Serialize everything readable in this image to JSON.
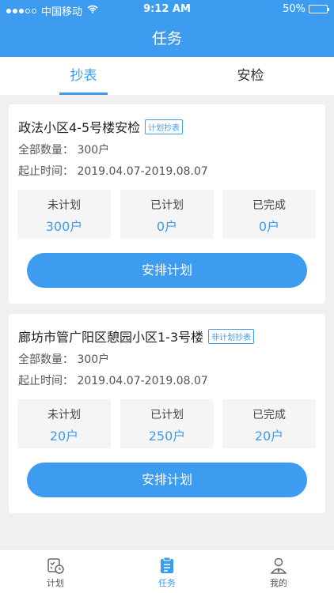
{
  "status_bar": {
    "carrier": "中国移动",
    "time": "9:12 AM",
    "battery": "50%"
  },
  "header": {
    "title": "任务"
  },
  "tabs": [
    {
      "label": "抄表"
    },
    {
      "label": "安检"
    }
  ],
  "tasks": [
    {
      "name": "政法小区4-5号楼安检",
      "tag": "计划抄表",
      "total": "全部数量：  300户",
      "period": "起止时间：  2019.04.07-2019.08.07",
      "stats": [
        {
          "label": "未计划",
          "value": "300户"
        },
        {
          "label": "已计划",
          "value": "0户"
        },
        {
          "label": "已完成",
          "value": "0户"
        }
      ],
      "button": "安排计划"
    },
    {
      "name": "廊坊市管广阳区憩园小区1-3号楼",
      "tag": "非计划抄表",
      "total": "全部数量：  300户",
      "period": "起止时间：  2019.04.07-2019.08.07",
      "stats": [
        {
          "label": "未计划",
          "value": "20户"
        },
        {
          "label": "已计划",
          "value": "250户"
        },
        {
          "label": "已完成",
          "value": "20户"
        }
      ],
      "button": "安排计划"
    }
  ],
  "bottom_nav": [
    {
      "label": "计划",
      "icon": "calendar-clock-icon"
    },
    {
      "label": "任务",
      "icon": "clipboard-icon"
    },
    {
      "label": "我的",
      "icon": "user-icon"
    }
  ],
  "colors": {
    "accent": "#3d9bf0"
  }
}
